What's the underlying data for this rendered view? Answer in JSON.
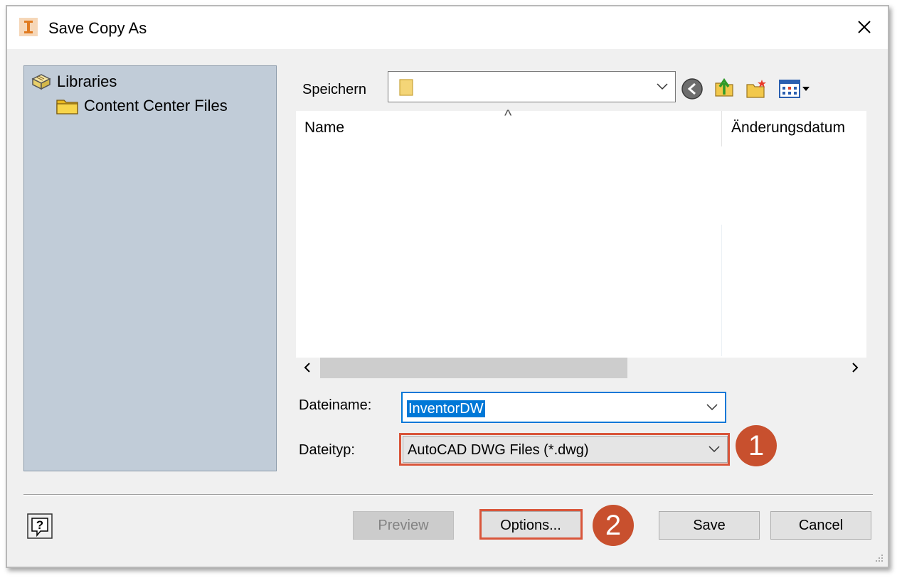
{
  "dialog": {
    "title": "Save Copy As",
    "close_label": "×"
  },
  "places": {
    "items": [
      {
        "label": "Libraries",
        "icon": "libraries-icon"
      },
      {
        "label": "Content Center Files",
        "icon": "folder-icon"
      }
    ]
  },
  "location": {
    "label": "Speichern",
    "value": ""
  },
  "toolbar": {
    "back_icon": "back-icon",
    "up_icon": "up-folder-icon",
    "new_folder_icon": "new-folder-icon",
    "view_icon": "view-menu-icon"
  },
  "filelist": {
    "columns": [
      "Name",
      "Änderungsdatum"
    ],
    "sort_indicator": "^"
  },
  "filename": {
    "label": "Dateiname:",
    "value": "InventorDW"
  },
  "filetype": {
    "label": "Dateityp:",
    "value": "AutoCAD DWG Files (*.dwg)"
  },
  "callouts": [
    "1",
    "2"
  ],
  "buttons": {
    "preview": "Preview",
    "options": "Options...",
    "save": "Save",
    "cancel": "Cancel"
  },
  "colors": {
    "places_bg": "#c1ccd8",
    "selection": "#0078d7",
    "highlight": "#d9553a",
    "callout": "#c8502e"
  }
}
